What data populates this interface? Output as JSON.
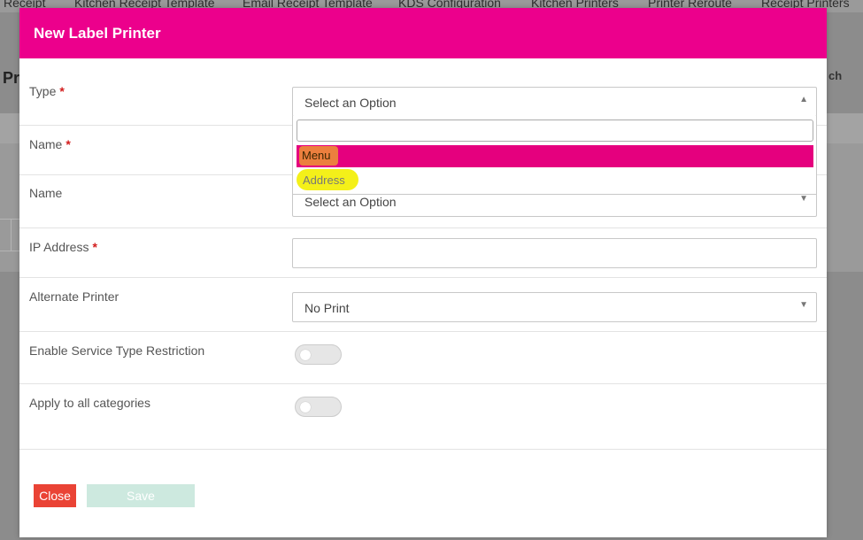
{
  "background": {
    "nav_tabs": [
      "Receipt",
      "Kitchen Receipt Template",
      "Email Receipt Template",
      "KDS Configuration",
      "Kitchen Printers",
      "Printer Reroute",
      "Receipt Printers"
    ],
    "heading_partial": "Pr",
    "search_partial": "ch"
  },
  "modal": {
    "title": "New Label Printer",
    "fields": {
      "type": {
        "label": "Type",
        "required_mark": "*",
        "value": "Select an Option",
        "caret": "▲"
      },
      "name1": {
        "label": "Name",
        "required_mark": "*"
      },
      "name2": {
        "label": "Name",
        "value": "Select an Option",
        "caret": "▼"
      },
      "ip": {
        "label": "IP Address",
        "required_mark": "*",
        "value": ""
      },
      "alt_printer": {
        "label": "Alternate Printer",
        "value": "No Print",
        "caret": "▼"
      },
      "service_restriction": {
        "label": "Enable Service Type Restriction",
        "enabled": false
      },
      "apply_all": {
        "label": "Apply to all categories",
        "enabled": false
      }
    },
    "dropdown": {
      "search_value": "",
      "options": [
        "Menu",
        "Address"
      ],
      "highlighted": "Menu"
    },
    "buttons": {
      "close": "Close",
      "save": "Save"
    }
  },
  "colors": {
    "brand": "#ec008c",
    "option_highlight": "#e5007e",
    "annotation_yellow": "#f3ee00",
    "close_button": "#ea4335",
    "save_button_disabled": "#cde9df"
  }
}
